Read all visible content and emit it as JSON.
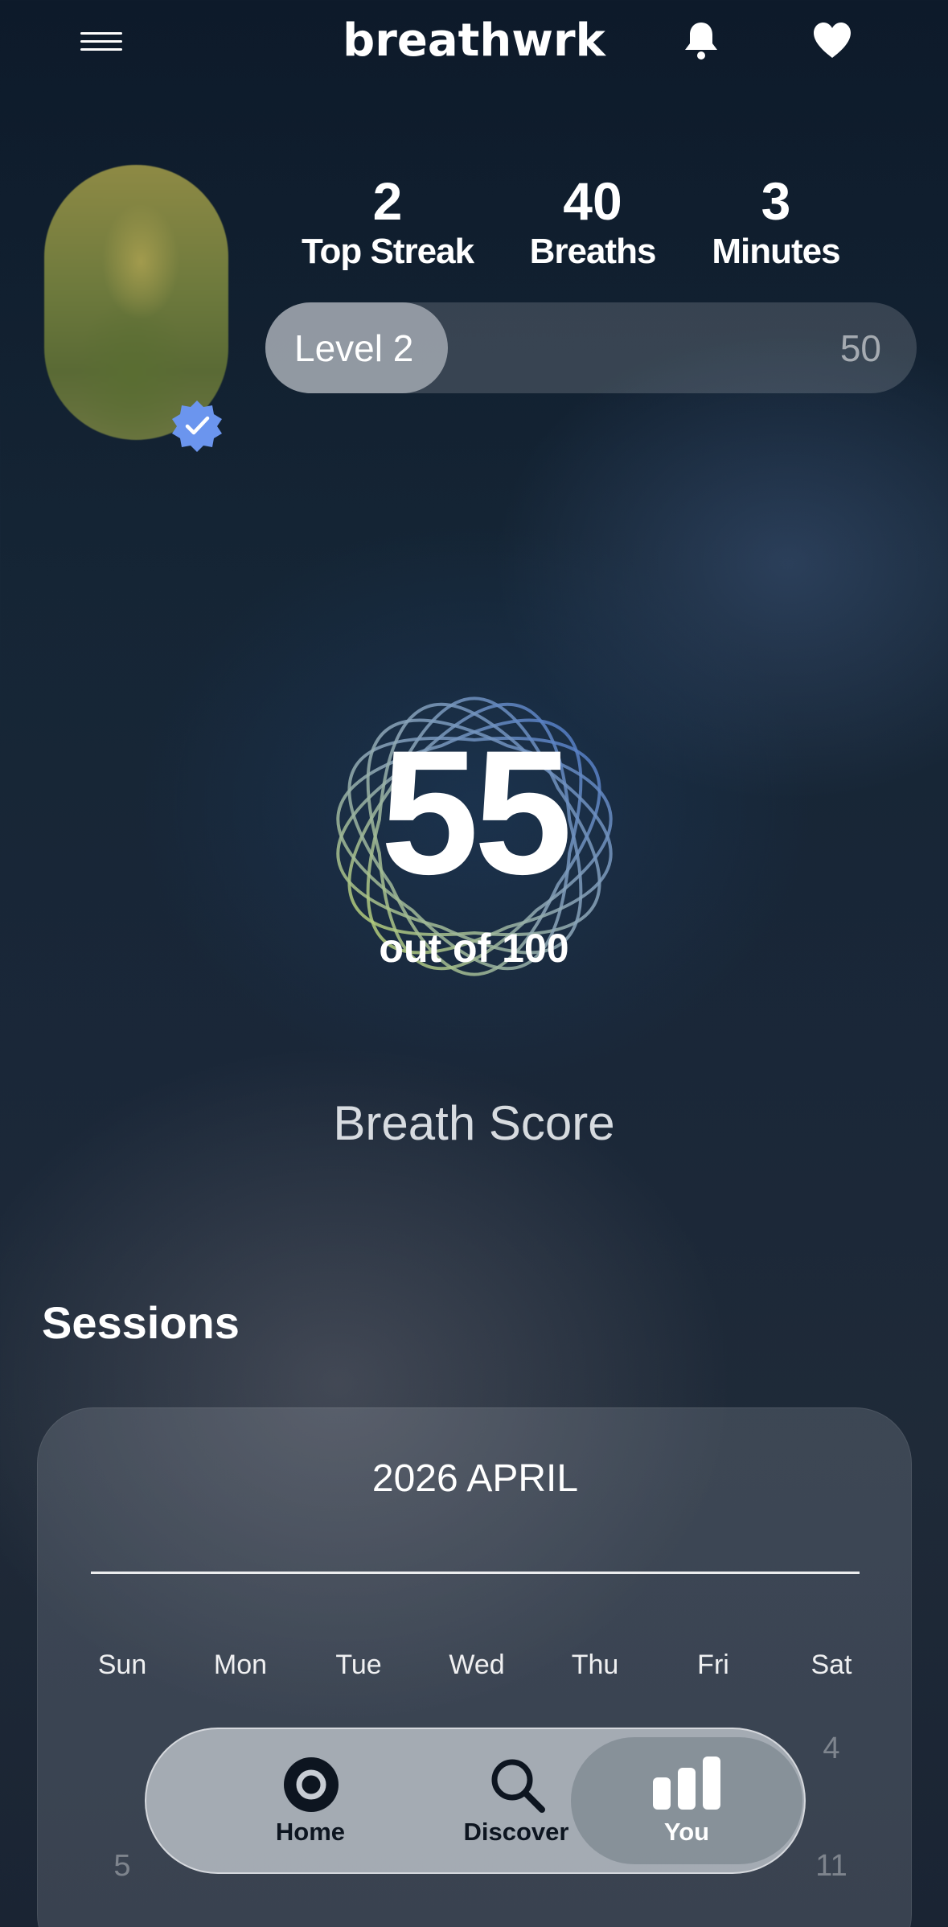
{
  "header": {
    "logo": "breathwrk",
    "icons": [
      "menu-icon",
      "bell-icon",
      "heart-icon"
    ]
  },
  "profile": {
    "verified": true,
    "stats": [
      {
        "value": "2",
        "label": "Top Streak"
      },
      {
        "value": "40",
        "label": "Breaths"
      },
      {
        "value": "3",
        "label": "Minutes"
      }
    ],
    "level": {
      "label": "Level 2",
      "max": "50",
      "progress_fraction": 0.28
    }
  },
  "score": {
    "value": "55",
    "out_of": "out of 100",
    "title": "Breath Score"
  },
  "sessions": {
    "title": "Sessions",
    "month": "2026 APRIL",
    "weekdays": [
      "Sun",
      "Mon",
      "Tue",
      "Wed",
      "Thu",
      "Fri",
      "Sat"
    ],
    "visible_days": [
      "4",
      "5",
      "11"
    ]
  },
  "tabbar": {
    "home": "Home",
    "discover": "Discover",
    "you": "You",
    "active": "You"
  },
  "colors": {
    "background": "#152535",
    "accent_blue": "#6b95ee",
    "rosette_green": "#a9c36b",
    "rosette_blue": "#4f7ac8"
  }
}
